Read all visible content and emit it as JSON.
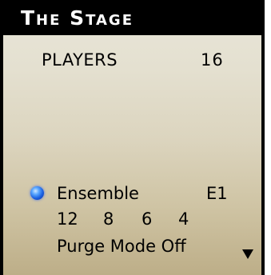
{
  "header": {
    "title": "The Stage"
  },
  "players": {
    "label": "PLAYERS",
    "count": "16"
  },
  "ensemble": {
    "indicator_color": "#2a6cff",
    "label": "Ensemble",
    "id": "E1",
    "values": [
      "12",
      "8",
      "6",
      "4"
    ]
  },
  "purge": {
    "label": "Purge Mode Off",
    "arrow_icon": "triangle-down-icon"
  }
}
